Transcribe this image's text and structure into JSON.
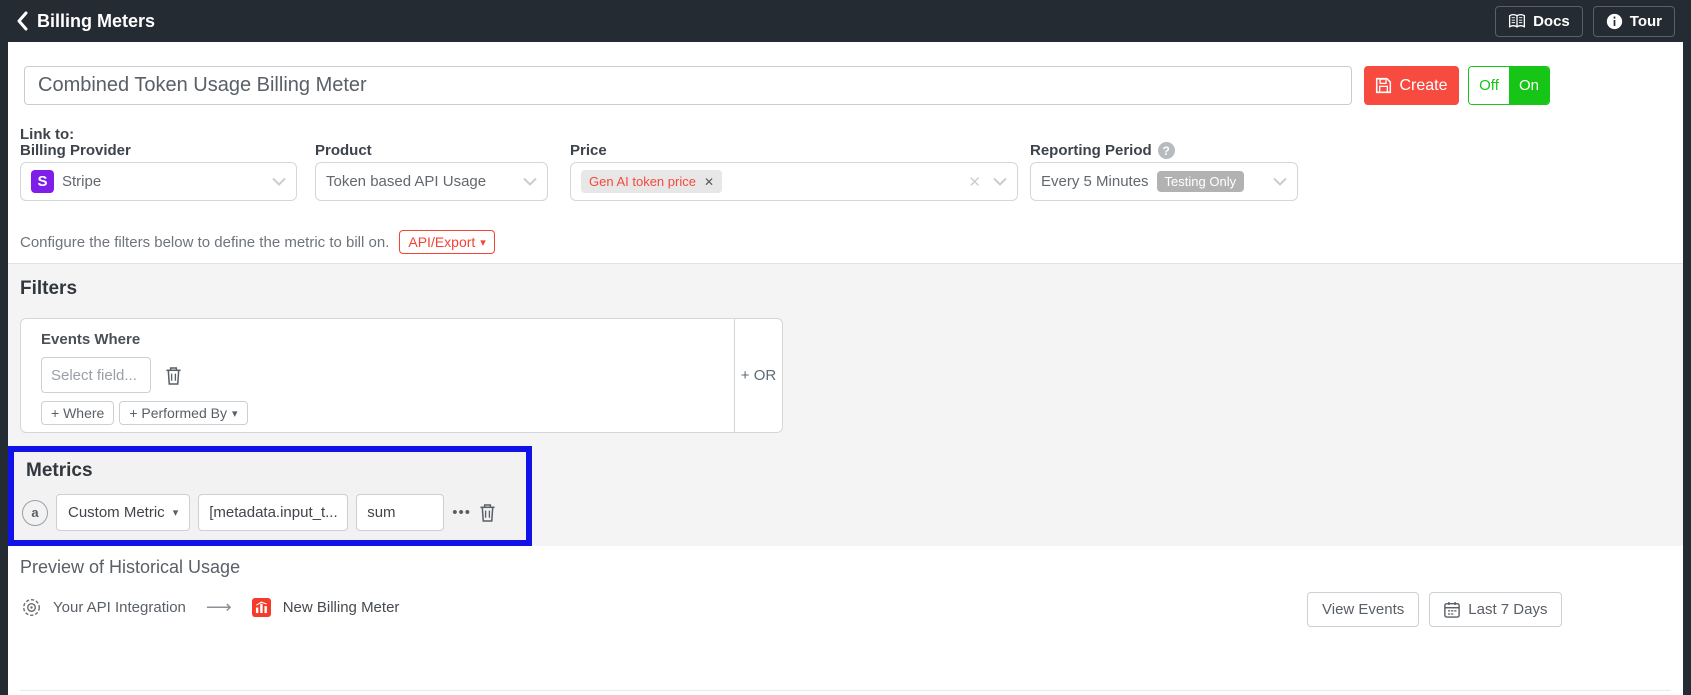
{
  "topbar": {
    "back_label": "Billing Meters",
    "docs_label": "Docs",
    "tour_label": "Tour"
  },
  "header": {
    "meter_name": "Combined Token Usage Billing Meter",
    "create_label": "Create",
    "toggle_off": "Off",
    "toggle_on": "On"
  },
  "link_to": {
    "section_label": "Link to:",
    "billing_provider": {
      "label": "Billing Provider",
      "value": "Stripe",
      "icon": "stripe-icon",
      "icon_letter": "S"
    },
    "product": {
      "label": "Product",
      "value": "Token based API Usage"
    },
    "price": {
      "label": "Price",
      "selected_tag": "Gen AI token price",
      "tag_remove": "✕",
      "clear": "✕"
    },
    "reporting_period": {
      "label": "Reporting Period",
      "value": "Every 5 Minutes",
      "badge": "Testing Only",
      "help": "?"
    }
  },
  "configure_note": {
    "text": "Configure the filters below to define the metric to bill on.",
    "api_export_label": "API/Export",
    "caret": "▾"
  },
  "filters": {
    "heading": "Filters",
    "events_where_label": "Events Where",
    "select_field_placeholder": "Select field...",
    "add_where_label": "+ Where",
    "add_performed_by_label": "+ Performed By",
    "performed_by_caret": "▾",
    "or_label": "+ OR"
  },
  "metrics": {
    "heading": "Metrics",
    "row": {
      "badge": "a",
      "type_value": "Custom Metric",
      "type_caret": "▾",
      "field_value": "[metadata.input_t...",
      "aggregation_value": "sum",
      "more_label": "•••"
    },
    "highlight_color": "#1112e8"
  },
  "preview": {
    "heading": "Preview of Historical Usage",
    "source_label": "Your API Integration",
    "arrow": "⟶",
    "target_label": "New Billing Meter",
    "view_events_label": "View Events",
    "date_range_label": "Last 7 Days"
  },
  "colors": {
    "topbar_bg": "#242b33",
    "create_red": "#f84b40",
    "toggle_green": "#17c517",
    "stripe_purple": "#7d1fe8",
    "tag_red": "#f4493c",
    "highlight_blue": "#1112e8",
    "section_gray": "#f4f4f4"
  }
}
